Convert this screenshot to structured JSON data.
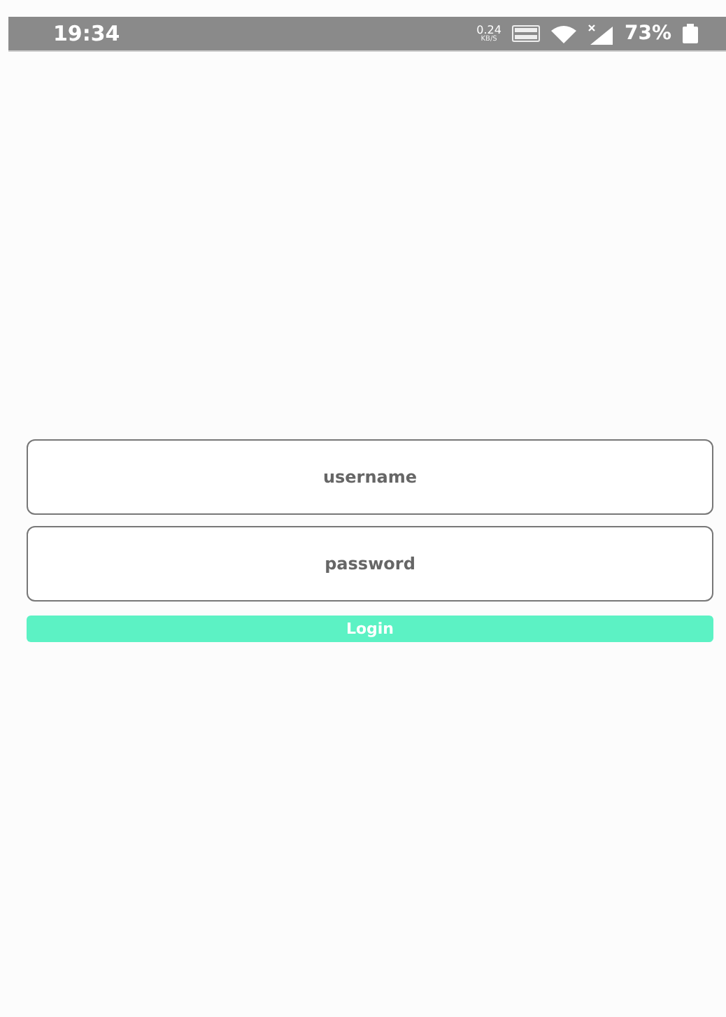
{
  "status_bar": {
    "time": "19:34",
    "net_speed": "0.24",
    "net_speed_unit": "KB/S",
    "battery": "73%"
  },
  "form": {
    "username": {
      "placeholder": "username"
    },
    "password": {
      "placeholder": "password"
    },
    "button": "Login"
  }
}
